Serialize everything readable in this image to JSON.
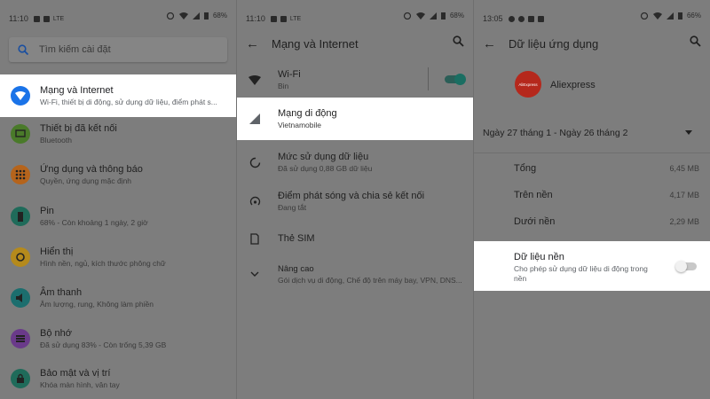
{
  "colors": {
    "accent": "#1a73e8",
    "highlight_bg": "#ffffff",
    "dim_bg": "#7d7d7d"
  },
  "panel1": {
    "status": {
      "time": "11:10",
      "net": "LTE",
      "battery": "68%"
    },
    "search_placeholder": "Tìm kiếm cài đặt",
    "items": [
      {
        "icon": "wifi-icon",
        "color": "#1a73e8",
        "title": "Mạng và Internet",
        "subtitle": "Wi-Fi, thiết bị di động, sử dụng dữ liệu, điểm phát s..."
      },
      {
        "icon": "devices-icon",
        "color": "#4a7a2a",
        "title": "Thiết bị đã kết nối",
        "subtitle": "Bluetooth"
      },
      {
        "icon": "apps-icon",
        "color": "#b5641c",
        "title": "Ứng dụng và thông báo",
        "subtitle": "Quyền, ứng dụng mặc định"
      },
      {
        "icon": "battery-icon",
        "color": "#1f6b5a",
        "title": "Pin",
        "subtitle": "68% - Còn khoảng 1 ngày, 2 giờ"
      },
      {
        "icon": "brightness-icon",
        "color": "#b58a1c",
        "title": "Hiển thị",
        "subtitle": "Hình nền, ngủ, kích thước phông chữ"
      },
      {
        "icon": "volume-icon",
        "color": "#1c6e6e",
        "title": "Âm thanh",
        "subtitle": "Âm lượng, rung, Không làm phiền"
      },
      {
        "icon": "storage-icon",
        "color": "#6a3a8a",
        "title": "Bộ nhớ",
        "subtitle": "Đã sử dụng 83% - Còn trống 5,39 GB"
      },
      {
        "icon": "lock-icon",
        "color": "#1f6b5a",
        "title": "Bảo mật và vị trí",
        "subtitle": "Khóa màn hình, vân tay"
      }
    ]
  },
  "panel2": {
    "status": {
      "time": "11:10",
      "net": "LTE",
      "battery": "68%"
    },
    "title": "Mạng và Internet",
    "rows": [
      {
        "icon": "wifi-icon",
        "title": "Wi-Fi",
        "subtitle": "Bin",
        "toggle": true
      },
      {
        "icon": "signal-icon",
        "title": "Mạng di động",
        "subtitle": "Vietnamobile",
        "highlight": true
      },
      {
        "icon": "data-usage-icon",
        "title": "Mức sử dụng dữ liệu",
        "subtitle": "Đã sử dụng 0,88 GB dữ liệu"
      },
      {
        "icon": "hotspot-icon",
        "title": "Điểm phát sóng và chia sẻ kết nối",
        "subtitle": "Đang tắt"
      },
      {
        "icon": "sim-icon",
        "title": "Thẻ SIM",
        "subtitle": ""
      },
      {
        "icon": "chevron-down-icon",
        "title": "Nâng cao",
        "subtitle": "Gói dịch vụ di động, Chế độ trên máy bay, VPN, DNS..."
      }
    ]
  },
  "panel3": {
    "status": {
      "time": "13:05",
      "net": "",
      "battery": "66%"
    },
    "title": "Dữ liệu ứng dụng",
    "app_name": "Aliexpress",
    "app_logo_text": "AliExpress",
    "date_range": "Ngày 27 tháng 1 - Ngày 26 tháng 2",
    "usage": [
      {
        "label": "Tổng",
        "value": "6,45 MB"
      },
      {
        "label": "Trên nền",
        "value": "4,17 MB"
      },
      {
        "label": "Dưới nền",
        "value": "2,29 MB"
      }
    ],
    "background": {
      "title": "Dữ liệu nền",
      "subtitle": "Cho phép sử dụng dữ liệu di động trong nền"
    }
  }
}
